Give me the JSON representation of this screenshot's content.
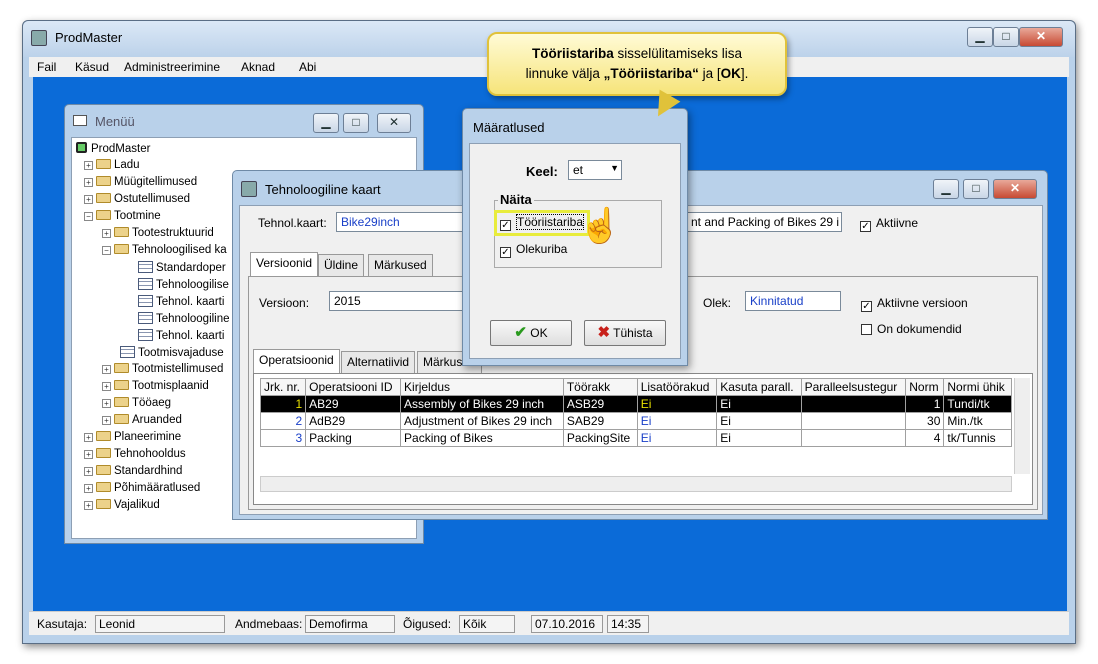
{
  "app": {
    "title": "ProdMaster"
  },
  "menubar": [
    "Fail",
    "Käsud",
    "Administreerimine",
    "Aknad",
    "Abi"
  ],
  "status": {
    "user_label": "Kasutaja:",
    "user": "Leonid",
    "db_label": "Andmebaas:",
    "db": "Demofirma",
    "rights_label": "Õigused:",
    "rights": "Kõik",
    "date": "07.10.2016",
    "time": "14:35"
  },
  "menu_window": {
    "title": "Menüü",
    "tree": [
      "ProdMaster",
      "Ladu",
      "Müügitellimused",
      "Ostutellimused",
      "Tootmine",
      "Tootestruktuurid",
      "Tehnoloogilised ka",
      "Standardoper",
      "Tehnoloogilise",
      "Tehnol. kaarti",
      "Tehnoloogiline",
      "Tehnol. kaarti",
      "Tootmisvajaduse",
      "Tootmistellimused",
      "Tootmisplaanid",
      "Tööaeg",
      "Aruanded",
      "Planeerimine",
      "Tehnohooldus",
      "Standardhind",
      "Põhimääratlused",
      "Vajalikud"
    ]
  },
  "tech_window": {
    "title": "Tehnoloogiline kaart",
    "card_label": "Tehnol.kaart:",
    "card_value": "Bike29inch",
    "desc_value": "nt and Packing of Bikes 29 i",
    "active_label": "Aktiivne",
    "tabs": [
      "Versioonid",
      "Üldine",
      "Märkused"
    ],
    "version_label": "Versioon:",
    "version_value": "2015",
    "state_label": "Olek:",
    "state_value": "Kinnitatud",
    "active_version_label": "Aktiivne versioon",
    "documented_label": "On dokumendid",
    "subtabs": [
      "Operatsioonid",
      "Alternatiivid",
      "Märkused"
    ],
    "columns": [
      "Jrk. nr.",
      "Operatsiooni ID",
      "Kirjeldus",
      "Töörakk",
      "Lisatöörakud",
      "Kasuta parall.",
      "Paralleelsustegur",
      "Norm",
      "Normi ühik"
    ],
    "rows": [
      [
        "1",
        "AB29",
        "Assembly of Bikes 29 inch",
        "ASB29",
        "Ei",
        "Ei",
        "",
        "1",
        "Tundi/tk"
      ],
      [
        "2",
        "AdB29",
        "Adjustment of Bikes 29 inch",
        "SAB29",
        "Ei",
        "Ei",
        "",
        "30",
        "Min./tk"
      ],
      [
        "3",
        "Packing",
        "Packing of Bikes",
        "PackingSite",
        "Ei",
        "Ei",
        "",
        "4",
        "tk/Tunnis"
      ]
    ]
  },
  "dialog": {
    "title": "Määratlused",
    "lang_label": "Keel:",
    "lang_value": "et",
    "group_label": "Näita",
    "toolbar_label": "Tööriistariba",
    "statusbar_label": "Olekuriba",
    "ok_label": "OK",
    "cancel_label": "Tühista"
  },
  "callout": {
    "b1": "Tööriistariba",
    "t1": " sisselülitamiseks lisa",
    "t2": "linnuke välja ",
    "b2": "„Tööriistariba“",
    "t3": " ja [",
    "b3": "OK",
    "t4": "]."
  }
}
